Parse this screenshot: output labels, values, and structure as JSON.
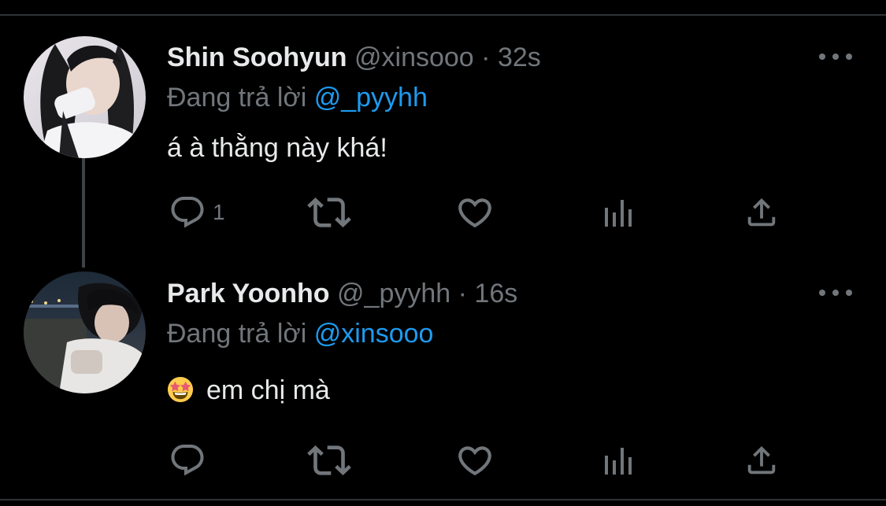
{
  "tweets": [
    {
      "name": "Shin Soohyun",
      "handle": "@xinsooo",
      "dot": "·",
      "time": "32s",
      "reply_prefix": "Đang trả lời",
      "reply_mention": "@_pyyhh",
      "text": "á à thằng này khá!",
      "reply_count": "1"
    },
    {
      "name": "Park Yoonho",
      "handle": "@_pyyhh",
      "dot": "·",
      "time": "16s",
      "reply_prefix": "Đang trả lời",
      "reply_mention": "@xinsooo",
      "emoji": "star-struck-emoji",
      "text": "em chị mà",
      "reply_count": ""
    }
  ],
  "icons": {
    "reply": "comment-icon",
    "retweet": "retweet-icon",
    "like": "heart-icon",
    "analytics": "analytics-icon",
    "share": "share-icon",
    "more": "more-dots-icon"
  },
  "colors": {
    "background": "#000000",
    "text_primary": "#e7e9ea",
    "text_secondary": "#71767b",
    "accent": "#1d9bf0",
    "divider": "#2f3336"
  }
}
